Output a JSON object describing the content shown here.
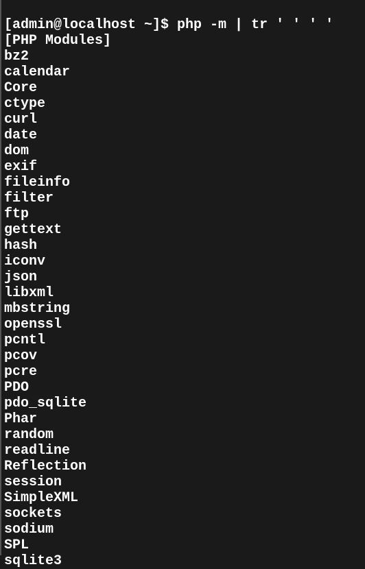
{
  "prompt": "[admin@localhost ~]$ ",
  "command": "php -m | tr ' ' ' '",
  "header": "[PHP Modules]",
  "modules": [
    "bz2",
    "calendar",
    "Core",
    "ctype",
    "curl",
    "date",
    "dom",
    "exif",
    "fileinfo",
    "filter",
    "ftp",
    "gettext",
    "hash",
    "iconv",
    "json",
    "libxml",
    "mbstring",
    "openssl",
    "pcntl",
    "pcov",
    "pcre",
    "PDO",
    "pdo_sqlite",
    "Phar",
    "random",
    "readline",
    "Reflection",
    "session",
    "SimpleXML",
    "sockets",
    "sodium",
    "SPL",
    "sqlite3"
  ]
}
